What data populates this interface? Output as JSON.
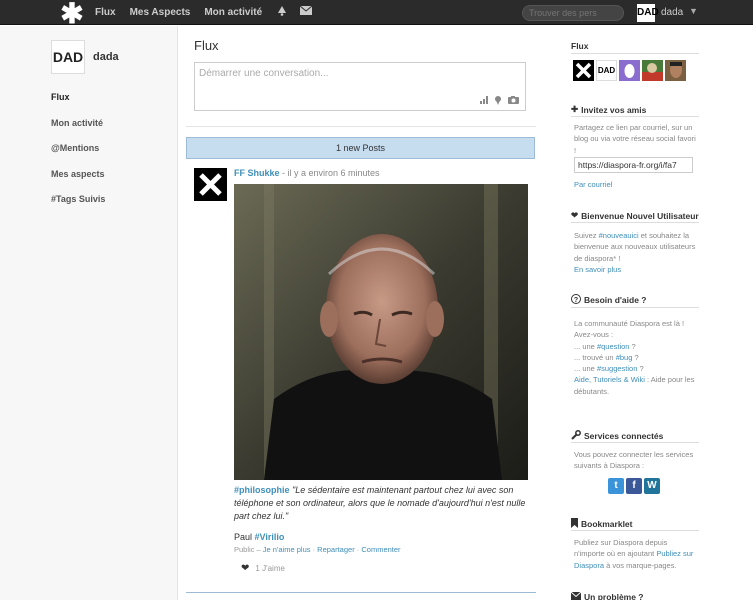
{
  "topbar": {
    "logo": "✱",
    "nav": [
      "Flux",
      "Mes Aspects",
      "Mon activité"
    ],
    "search_placeholder": "Trouver des pers",
    "user_name": "dada",
    "user_avatar_text": "DAD"
  },
  "sidebar": {
    "profile_name": "dada",
    "avatar_text": "DAD",
    "items": [
      "Flux",
      "Mon activité",
      "@Mentions",
      "Mes aspects",
      "#Tags Suivis"
    ]
  },
  "main": {
    "title": "Flux",
    "publisher_placeholder": "Démarrer une conversation...",
    "new_posts": "1 new Posts",
    "post": {
      "author": "FF Shukke",
      "time": " - il y a environ 6 minutes",
      "tag": "#philosophie",
      "text": "\"Le sédentaire est maintenant partout chez lui avec son téléphone et son ordinateur, alors que le nomade d'aujourd'hui n'est nulle part chez lui.\"",
      "sign_name": "Paul ",
      "sign_tag": "#Virilio",
      "meta_public": "Public – ",
      "meta_unlike": "Je n'aime plus",
      "meta_dot1": " · ",
      "meta_share": "Repartager",
      "meta_dot2": " · ",
      "meta_comment": "Commenter",
      "likes": "1 J'aime"
    }
  },
  "right": {
    "flux_title": "Flux",
    "invite_title": "Invitez vos amis",
    "invite_text": "Partagez ce lien par courriel, sur un blog ou via votre réseau social favori !",
    "invite_url": "https://diaspora-fr.org/i/fa7",
    "invite_mail": "Par courriel",
    "welcome_title": "Bienvenue Nouvel Utilisateur",
    "welcome_text1": "Suivez ",
    "welcome_tag": "#nouveauici",
    "welcome_text2": " et souhaitez la bienvenue aux nouveaux utilisateurs de diaspora* !",
    "welcome_more": "En savoir plus",
    "help_title": "Besoin d'aide ?",
    "help_line1": "La communauté Diaspora est là !",
    "help_line2": "Avez-vous :",
    "help_q_pre": "... une ",
    "help_q_tag": "#question",
    "help_q_post": " ?",
    "help_b_pre": "... trouvé un ",
    "help_b_tag": "#bug",
    "help_b_post": " ?",
    "help_s_pre": "... une ",
    "help_s_tag": "#suggestion",
    "help_s_post": " ?",
    "help_links": "Aide, Tutoriels & Wiki",
    "help_links_post": " : Aide pour les débutants.",
    "services_title": "Services connectés",
    "services_text": "Vous pouvez connecter les services suivants à Diaspora :",
    "bookmarklet_title": "Bookmarklet",
    "bookmarklet_text1": "Publiez sur Diaspora depuis n'importe où en ajoutant ",
    "bookmarklet_link": "Publiez sur Diaspora",
    "bookmarklet_text2": " à vos marque-pages.",
    "problem_title": "Un problème ?"
  },
  "colors": {
    "accent": "#3f8fba",
    "topbar": "#2b2b2b",
    "banner": "#c6dcef"
  }
}
